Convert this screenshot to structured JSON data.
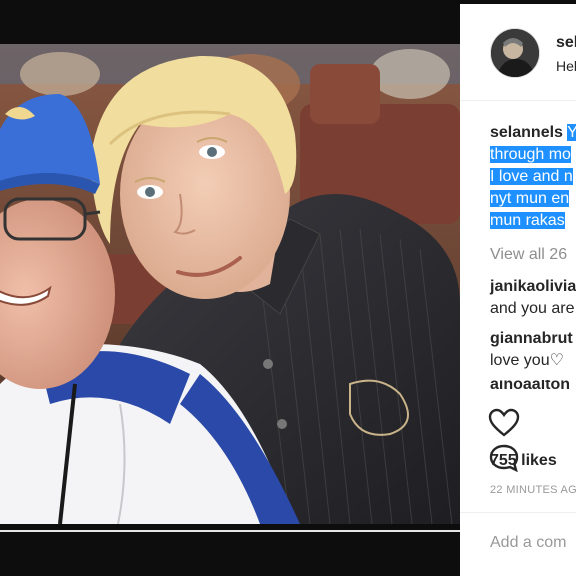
{
  "post": {
    "username": "sel",
    "location": "Hel",
    "caption": {
      "author": "selannels",
      "first_line_highlight": "Y",
      "lines": [
        "through mo",
        "I love and n",
        "nyt mun en",
        "mun rakas"
      ]
    },
    "view_all": "View all 26",
    "comments": [
      {
        "user": "janikaolivia",
        "text": "and you are"
      },
      {
        "user": "giannabrut",
        "text": "love you♡"
      },
      {
        "user": "ainoaalton",
        "text": ""
      }
    ],
    "likes": "755 likes",
    "time": "22 MINUTES AG",
    "add_comment_placeholder": "Add a com"
  },
  "colors": {
    "highlight": "#1e90ff",
    "text": "#262626",
    "muted": "#8e8e8e",
    "cap_blue": "#3a6fd8",
    "shirt": "#2b2b30"
  },
  "icons": [
    "heart-icon",
    "comment-icon"
  ]
}
